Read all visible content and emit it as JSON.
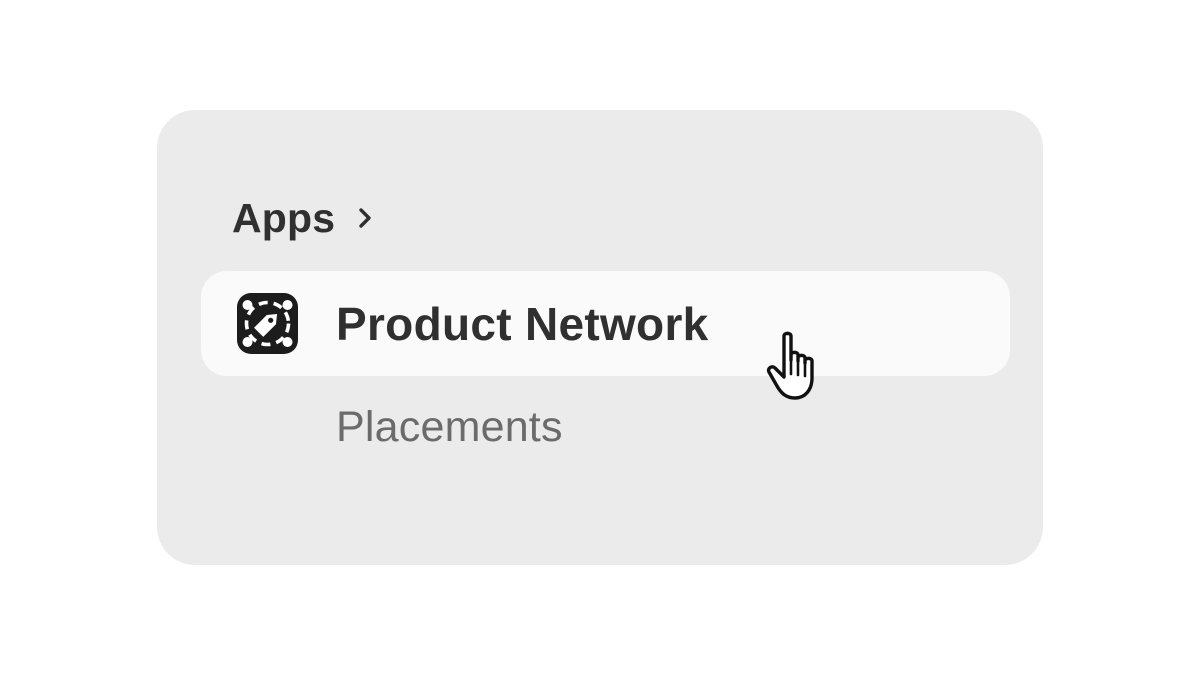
{
  "nav": {
    "section_label": "Apps",
    "section_icon": "chevron-right-icon",
    "active_item": {
      "label": "Product Network",
      "icon": "product-network-tag-icon",
      "state": "hovered"
    },
    "sub_items": [
      {
        "label": "Placements"
      }
    ]
  },
  "pointer": {
    "icon": "hand-pointer-cursor"
  },
  "colors": {
    "card_background": "#ebebeb",
    "hover_background": "#fafafa",
    "primary_text": "#303030",
    "secondary_text": "#6b6b6b",
    "icon_fill": "#1c1c1c"
  }
}
